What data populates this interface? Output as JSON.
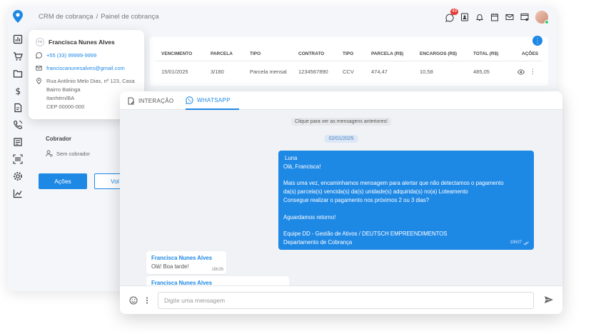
{
  "breadcrumb": {
    "first": "CRM de cobrança",
    "separator": "/",
    "second": "Painel de cobrança"
  },
  "topbar": {
    "whatsapp_badge": "49"
  },
  "table": {
    "headers": [
      "VENCIMENTO",
      "PARCELA",
      "TIPO",
      "CONTRATO",
      "TIPO",
      "PARCELA (R$)",
      "ENCARGOS (R$)",
      "TOTAL (R$)",
      "AÇÕES"
    ],
    "row": [
      "15/01/2025",
      "3/180",
      "Parcela mensal",
      "1234567890",
      "CCV",
      "474,47",
      "10,58",
      "485,05"
    ]
  },
  "contact": {
    "initials": "FN",
    "name": "Francisca Nunes Alves",
    "phone": "+55 (33) 99999-9999",
    "email": "franciscanunesalves@gmail.com",
    "address": [
      "Rua Antônio Melo Dias, nº 123, Casa",
      "Bairro Batinga",
      "Itanhém/BA",
      "CEP 00000-000"
    ]
  },
  "left_panel": {
    "collector_label": "Cobrador",
    "collector_value": "Sem cobrador",
    "actions_button": "Ações",
    "second_button": "Vol"
  },
  "chat": {
    "tab_interaction": "INTERAÇÃO",
    "tab_whatsapp": "WHATSAPP",
    "load_previous": "Clique para ver as mensagens anteriores!",
    "date": "02/01/2025",
    "outgoing": {
      "sender": "Luna",
      "greeting": "Olá, Francisca!",
      "line1": "Mais uma vez, encaminhamos mensagem para alertar que não detectamos o pagamento",
      "line2": "da(s) parcela(s) vencida(s) da(s) unidade(s) adquirida(s) no(a) Loteamento",
      "line3": "Consegue realizar o pagamento nos próximos 2 ou 3 dias?",
      "line4": "Aguardamos retorno!",
      "sig1": "Equipe DD - Gestão de Ativos / DEUTSCH EMPREENDIMENTOS",
      "sig2": "Departamento de Cobrança",
      "time": "10h07"
    },
    "incoming1": {
      "sender": "Francisca Nunes Alves",
      "body": "Olá! Boa tarde!",
      "time": "18h26"
    },
    "incoming2": {
      "sender": "Francisca Nunes Alves"
    },
    "input_placeholder": "Digite uma mensagem"
  },
  "colors": {
    "primary": "#1e88e5",
    "badge": "#e53935",
    "online": "#2ecc71"
  },
  "icons": [
    "location-pin-icon",
    "dashboard-icon",
    "cart-icon",
    "folder-icon",
    "dollar-icon",
    "document-edit-icon",
    "phone-icon",
    "list-icon",
    "barcode-icon",
    "gear-icon",
    "chart-icon",
    "whatsapp-icon",
    "contacts-icon",
    "bell-icon",
    "calendar-icon",
    "mail-icon",
    "window-icon",
    "emoji-icon",
    "more-vertical-icon",
    "send-icon",
    "eye-icon"
  ]
}
